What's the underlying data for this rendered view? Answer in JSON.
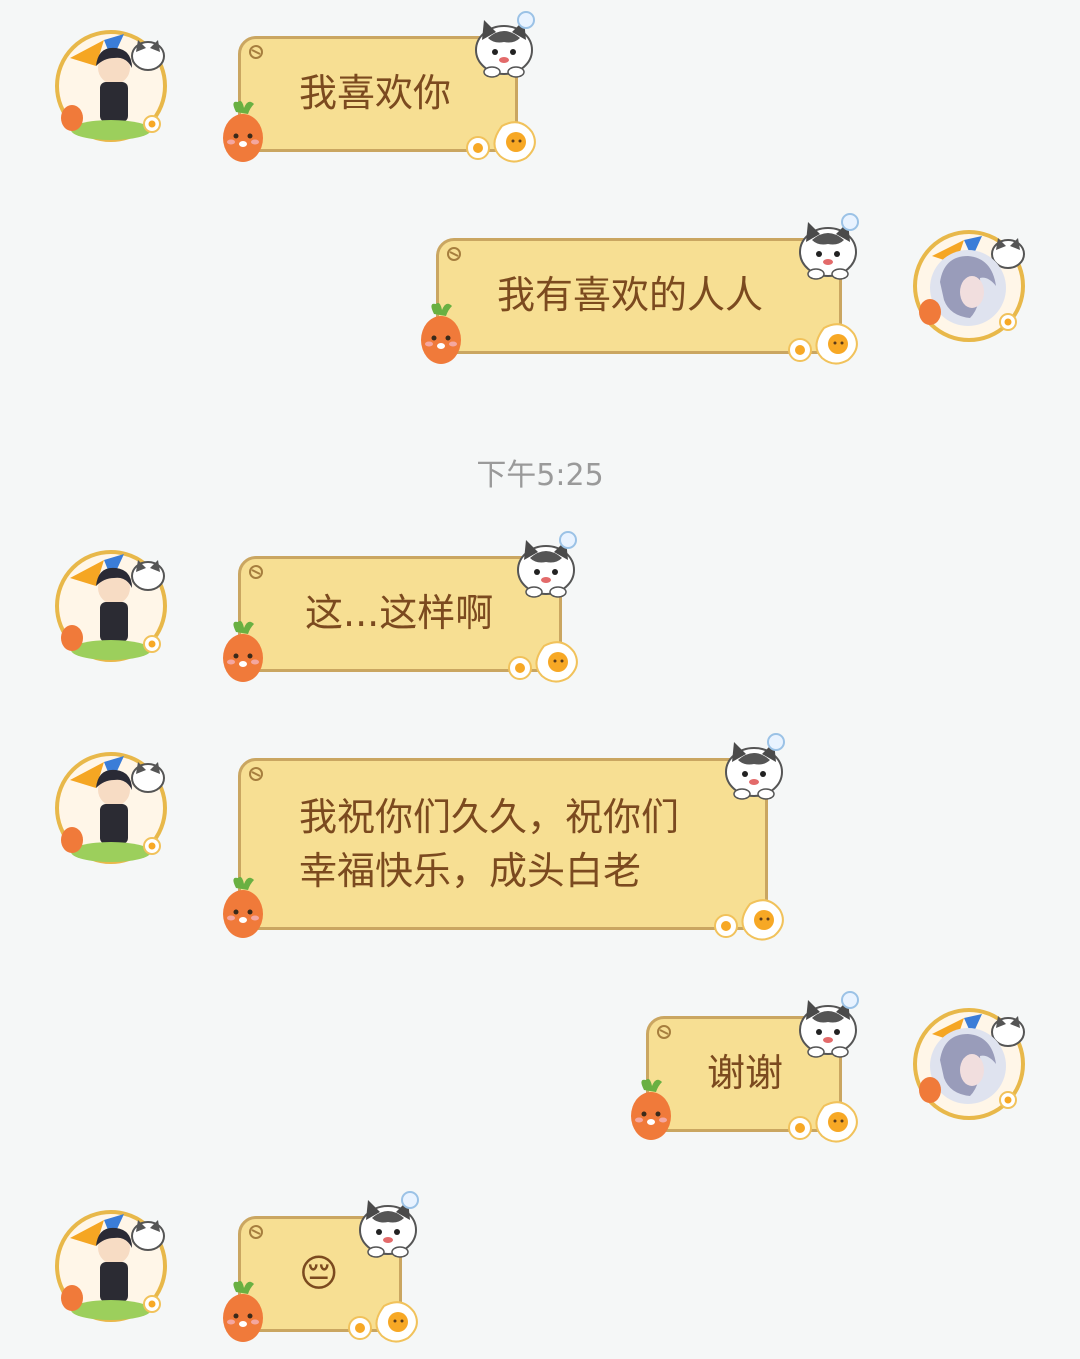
{
  "timestamp": "下午5:25",
  "messages": [
    {
      "side": "left",
      "text": "我喜欢你"
    },
    {
      "side": "right",
      "text": "我有喜欢的人人"
    },
    {
      "side": "left",
      "text": "这...这样啊"
    },
    {
      "side": "left",
      "line1": "我祝你们久久，祝你们",
      "line2": "幸福快乐，成头白老"
    },
    {
      "side": "right",
      "text": "谢谢"
    },
    {
      "side": "left",
      "emoji": "😔"
    }
  ],
  "colors": {
    "bubble_fill": "#f7df93",
    "bubble_border": "#caa661",
    "bubble_text": "#7b4a1f",
    "background": "#f5f7f7",
    "timestamp": "#9a9a9a"
  },
  "icons": {
    "left_avatar": "anime-boy-avatar",
    "right_avatar": "anime-girl-avatar",
    "bubble_decorations": [
      "cat-icon",
      "carrot-icon",
      "fried-egg-icon"
    ]
  }
}
